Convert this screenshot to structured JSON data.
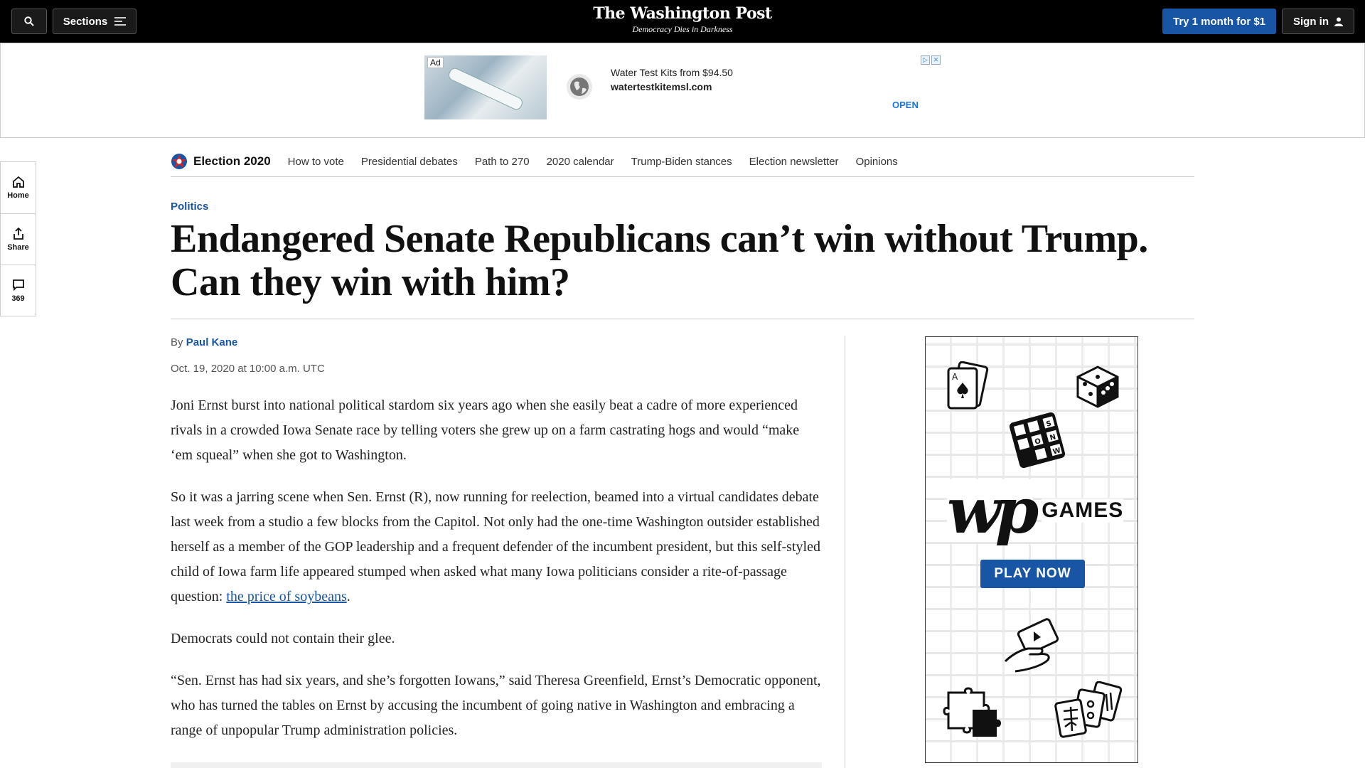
{
  "topbar": {
    "sections_label": "Sections",
    "logo_name": "The Washington Post",
    "logo_tagline": "Democracy Dies in Darkness",
    "subscribe_label": "Try 1 month for $1",
    "signin_label": "Sign in"
  },
  "ad": {
    "badge": "Ad",
    "headline": "Water Test Kits from $94.50",
    "domain": "watertestkitemsl.com",
    "cta": "OPEN"
  },
  "rail": {
    "home_label": "Home",
    "share_label": "Share",
    "comments_count": "369"
  },
  "election_nav": {
    "brand": "Election 2020",
    "links": [
      "How to vote",
      "Presidential debates",
      "Path to 270",
      "2020 calendar",
      "Trump-Biden stances",
      "Election newsletter",
      "Opinions"
    ]
  },
  "article": {
    "kicker": "Politics",
    "headline": "Endangered Senate Republicans can’t win without Trump. Can they win with him?",
    "byline_prefix": "By",
    "author": "Paul Kane",
    "date": "Oct. 19, 2020 at 10:00 a.m. UTC",
    "p1": "Joni Ernst burst into national political stardom six years ago when she easily beat a cadre of more experienced rivals in a crowded Iowa Senate race by telling voters she grew up on a farm castrating hogs and would “make ‘em squeal” when she got to Washington.",
    "p2_before_link": "So it was a jarring scene when Sen. Ernst (R), now running for reelection, beamed into a virtual candidates debate last week from a studio a few blocks from the Capitol. Not only had the one-time Washington outsider established herself as a member of the GOP leadership and a frequent defender of the incumbent president, but this self-styled child of Iowa farm life appeared stumped when asked what many Iowa politicians consider a rite-of-passage question: ",
    "p2_link": "the price of soybeans",
    "p2_after_link": ".",
    "p3": "Democrats could not contain their glee.",
    "p4": "“Sen. Ernst has had six years, and she’s forgotten Iowans,” said Theresa Greenfield, Ernst’s Democratic opponent, who has turned the tables on Ernst by accusing the incumbent of going native in Washington and embracing a range of unpopular Trump administration policies."
  },
  "games_ad": {
    "mark": "wp",
    "word": "GAMES",
    "cta": "PLAY NOW",
    "card_rank": "A",
    "tile_letters": [
      "S",
      "O",
      "N",
      "W"
    ]
  },
  "colors": {
    "topbar": "#000000",
    "accent_blue": "#1955a5",
    "ad_open": "#1a73e8"
  }
}
